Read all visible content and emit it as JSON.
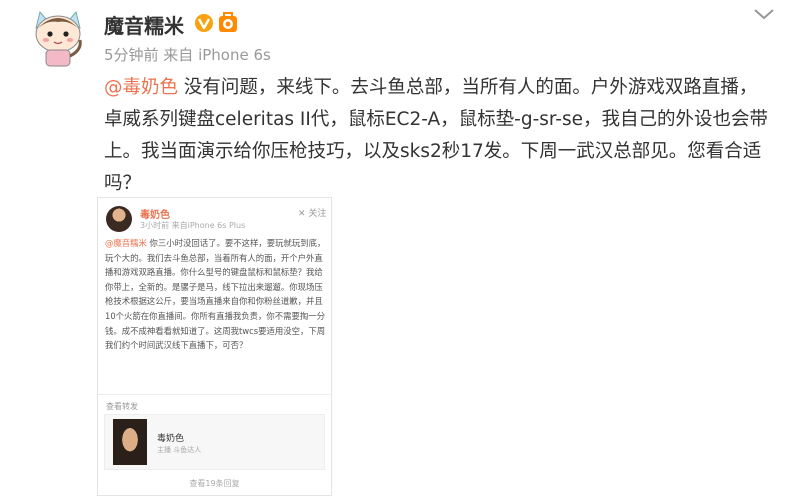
{
  "post": {
    "author": "魔音糯米",
    "meta": "5分钟前 来自 iPhone 6s",
    "mention": "@毒奶色",
    "body": " 没有问题，来线下。去斗鱼总部，当所有人的面。户外游戏双路直播，卓威系列键盘celeritas II代，鼠标EC2-A，鼠标垫-g-sr-se，我自己的外设也会带上。我当面演示给你压枪技巧，以及sks2秒17发。下周一武汉总部见。您看合适吗？"
  },
  "embed": {
    "author": "毒奶色",
    "meta": "3小时前 来自iPhone 6s Plus",
    "close": "✕ 关注",
    "mention": "@魔音糯米",
    "body": " 你三小时没回话了。要不这样，要玩就玩到底，玩个大的。我们去斗鱼总部，当着所有人的面，开个户外直播和游戏双路直播。你什么型号的键盘鼠标和鼠标垫？我给你带上，全新的。是骡子是马，线下拉出来遛遛。你现场压枪技术根据这公斤，要当场直播来自你和你粉丝道歉，并且10个火箭在你直播间。你所有直播我负责，你不需要掏一分钱。成不成神看看就知道了。这周我twcs要适用没空，下周我们约个时间武汉线下直播下，可否？",
    "reshare": "查看转发",
    "sub_name": "毒奶色",
    "sub_desc": "主播 斗鱼达人",
    "footer": "查看19条回复"
  },
  "icons": {
    "verified": "verified-v-icon",
    "medal": "medal-badge-icon",
    "menu": "chevron-down-icon"
  },
  "colors": {
    "mention": "#eb7350",
    "meta": "#999999",
    "text": "#333333",
    "verified": "#f6a30f"
  }
}
